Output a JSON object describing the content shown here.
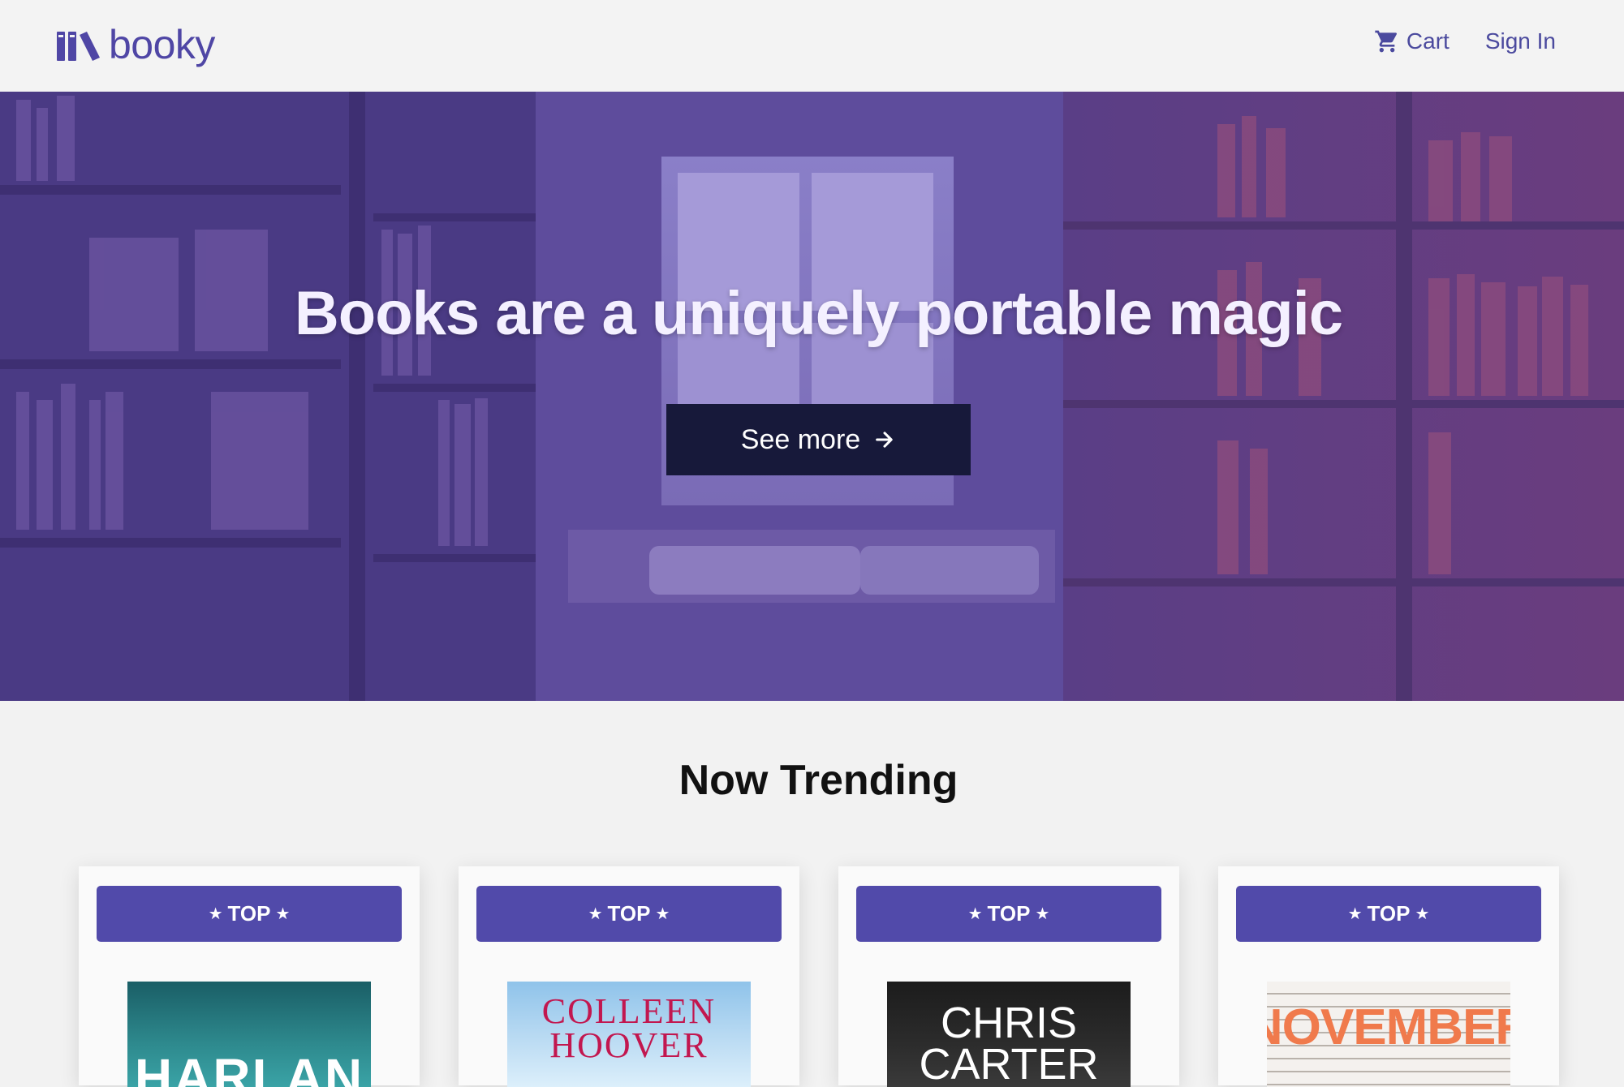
{
  "header": {
    "logo_text": "booky",
    "nav": {
      "cart_label": "Cart",
      "signin_label": "Sign In"
    }
  },
  "hero": {
    "title": "Books are a uniquely portable magic",
    "button_label": "See more"
  },
  "trending": {
    "title": "Now Trending",
    "cards": [
      {
        "badge": "TOP",
        "cover_text": "HARLAN"
      },
      {
        "badge": "TOP",
        "cover_text": "COLLEEN HOOVER"
      },
      {
        "badge": "TOP",
        "cover_text": "CHRIS CARTER"
      },
      {
        "badge": "TOP",
        "cover_text": "NOVEMBER"
      }
    ]
  },
  "icons": [
    "books-logo-icon",
    "cart-icon",
    "arrow-right-icon",
    "star-icon"
  ],
  "colors": {
    "brand": "#4f46a5",
    "badge": "#514aaa",
    "hero_button": "#17193a",
    "page_bg": "#f2f2f2"
  }
}
